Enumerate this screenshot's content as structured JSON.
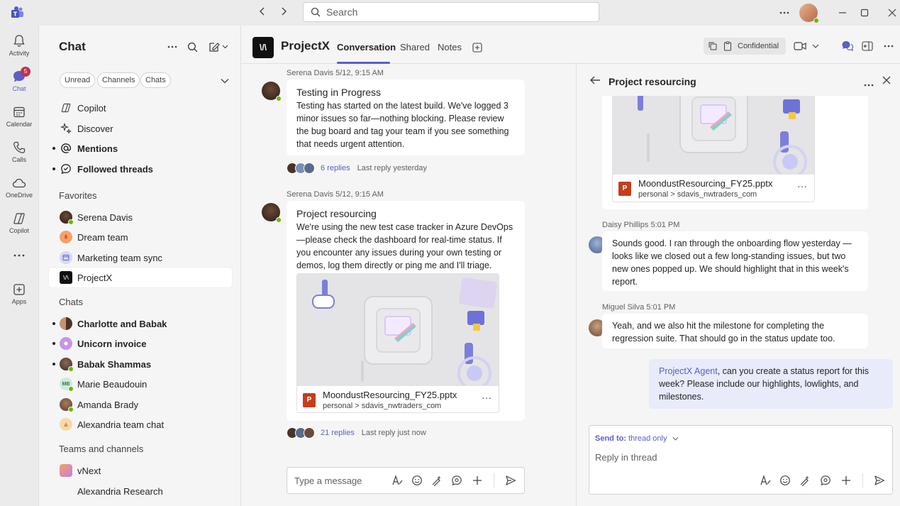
{
  "titlebar": {
    "search_placeholder": "Search",
    "icons": [
      "teams-logo",
      "back-arrow",
      "forward-arrow",
      "search-icon",
      "more-icon",
      "minimize-icon",
      "maximize-icon",
      "close-icon"
    ]
  },
  "rail": {
    "items": [
      {
        "label": "Activity",
        "icon": "bell-icon"
      },
      {
        "label": "Chat",
        "icon": "chat-icon",
        "badge": "5"
      },
      {
        "label": "Calendar",
        "icon": "calendar-icon"
      },
      {
        "label": "Calls",
        "icon": "phone-icon"
      },
      {
        "label": "OneDrive",
        "icon": "cloud-icon"
      },
      {
        "label": "Copilot",
        "icon": "copilot-icon"
      },
      {
        "label": "Apps",
        "icon": "add-app-icon"
      }
    ]
  },
  "chatlist": {
    "title": "Chat",
    "filters": [
      "Unread",
      "Channels",
      "Chats"
    ],
    "top_items": [
      {
        "label": "Copilot",
        "bold": false,
        "unread": false
      },
      {
        "label": "Discover",
        "bold": false,
        "unread": false
      },
      {
        "label": "Mentions",
        "bold": true,
        "unread": true
      },
      {
        "label": "Followed threads",
        "bold": true,
        "unread": true
      }
    ],
    "favorites_heading": "Favorites",
    "favorites": [
      {
        "label": "Serena Davis",
        "bold": false
      },
      {
        "label": "Dream team",
        "bold": false
      },
      {
        "label": "Marketing team sync",
        "bold": false
      },
      {
        "label": "ProjectX",
        "bold": false,
        "selected": true
      }
    ],
    "chats_heading": "Chats",
    "chats": [
      {
        "label": "Charlotte and Babak",
        "bold": true,
        "unread": true
      },
      {
        "label": "Unicorn invoice",
        "bold": true,
        "unread": true
      },
      {
        "label": "Babak Shammas",
        "bold": true,
        "unread": true
      },
      {
        "label": "Marie Beaudouin",
        "bold": false,
        "initials": "MB"
      },
      {
        "label": "Amanda Brady",
        "bold": false
      },
      {
        "label": "Alexandria team chat",
        "bold": false
      }
    ],
    "teams_heading": "Teams and channels",
    "teams": [
      {
        "label": "vNext"
      },
      {
        "label": "Alexandria Research"
      }
    ]
  },
  "conversation": {
    "logo_text": "\\/\\",
    "title": "ProjectX",
    "tabs": [
      "Conversation",
      "Shared",
      "Notes"
    ],
    "confidential_label": "Confidential",
    "messages": [
      {
        "author_time": "Serena Davis   5/12, 9:15 AM",
        "title": "Testing in Progress",
        "body": "Testing has started on the latest build. We've logged 3 minor issues so far—nothing blocking. Please review the bug board and tag your team if you see something that needs urgent attention.",
        "replies": "6 replies",
        "last_reply": "Last reply yesterday"
      },
      {
        "author_time": "Serena Davis   5/12, 9:15 AM",
        "title": "Project resourcing",
        "body": "We're using the new test case tracker in Azure DevOps—please check the dashboard for real-time status. If you encounter any issues during your own testing or demos, log them directly or ping me and I'll triage.",
        "attachment": {
          "name": "MoondustResourcing_FY25.pptx",
          "path": "personal > sdavis_nwtraders_com"
        },
        "replies": "21 replies",
        "last_reply": "Last reply just now"
      }
    ],
    "compose_placeholder": "Type a message"
  },
  "thread": {
    "title": "Project resourcing",
    "attachment": {
      "name": "MoondustResourcing_FY25.pptx",
      "path": "personal > sdavis_nwtraders_com"
    },
    "messages": [
      {
        "author_time": "Daisy Phillips   5:01 PM",
        "body": "Sounds good. I ran through the onboarding flow yesterday — looks like we closed out a few long-standing issues, but two new ones popped up. We should highlight that in this week's report."
      },
      {
        "author_time": "Miguel Silva   5:01 PM",
        "body": "Yeah, and we also hit the milestone for completing the regression suite. That should go in the status update too."
      },
      {
        "mention": "ProjectX Agent",
        "body": ", can you create a status report for this week? Please include our highlights, lowlights, and milestones."
      }
    ],
    "send_to_label": "Send to:",
    "send_to_value": "thread only",
    "compose_placeholder": "Reply in thread"
  },
  "colors": {
    "accent": "#5b5fc7",
    "presence": "#6bb700",
    "badge": "#c4314b",
    "my_bubble": "#e8ebfa"
  }
}
